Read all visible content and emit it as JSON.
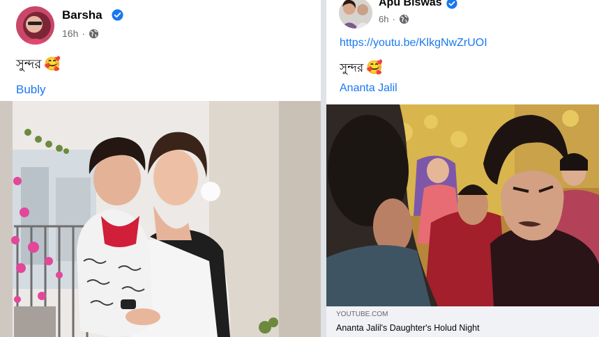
{
  "left_post": {
    "author": "Barsha",
    "time": "16h",
    "text": "সুন্দর",
    "emoji": "🥰",
    "tag": "Bubly"
  },
  "right_post": {
    "author": "Apu Biswas",
    "time": "6h",
    "link": "https://youtu.be/KlkgNwZrUOI",
    "text": "সুন্দর",
    "emoji": "🥰",
    "tag": "Ananta Jalil",
    "preview": {
      "domain": "YOUTUBE.COM",
      "title": "Ananta Jalil's Daughter's Holud Night"
    }
  },
  "colors": {
    "brand_blue": "#1877f2",
    "meta_gray": "#65676b"
  },
  "icons": [
    "verified-badge-icon",
    "globe-icon"
  ]
}
